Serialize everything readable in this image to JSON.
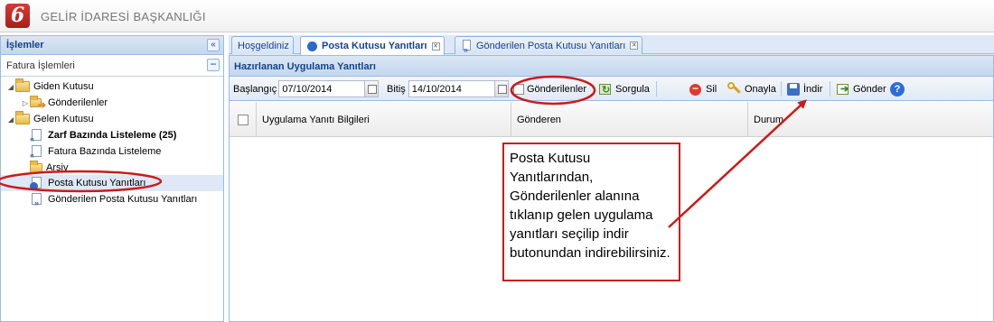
{
  "app": {
    "title": "GELİR İDARESİ BAŞKANLIĞI",
    "logo_letter": "6"
  },
  "sidebar": {
    "title": "İşlemler",
    "section_title": "Fatura İşlemleri",
    "items": [
      {
        "label": "Giden Kutusu"
      },
      {
        "label": "Gönderilenler"
      },
      {
        "label": "Gelen Kutusu"
      },
      {
        "label": "Zarf Bazında Listeleme (25)"
      },
      {
        "label": "Fatura Bazında Listeleme"
      },
      {
        "label": "Arşiv"
      },
      {
        "label": "Posta Kutusu Yanıtları"
      },
      {
        "label": "Gönderilen Posta Kutusu Yanıtları"
      }
    ]
  },
  "tabs": [
    {
      "label": "Hoşgeldiniz"
    },
    {
      "label": "Posta Kutusu Yanıtları"
    },
    {
      "label": "Gönderilen Posta Kutusu Yanıtları"
    }
  ],
  "panel": {
    "title": "Hazırlanan Uygulama Yanıtları"
  },
  "toolbar": {
    "start_label": "Başlangıç",
    "start_value": "07/10/2014",
    "end_label": "Bitiş",
    "end_value": "14/10/2014",
    "sent_label": "Gönderilenler",
    "query_label": "Sorgula",
    "delete_label": "Sil",
    "approve_label": "Onayla",
    "download_label": "İndir",
    "send_label": "Gönder",
    "help_symbol": "?"
  },
  "grid": {
    "columns": [
      "Uygulama Yanıtı Bilgileri",
      "Gönderen",
      "Durum"
    ]
  },
  "callout": {
    "text": "Posta Kutusu Yanıtlarından, Gönderilenler alanına tıklanıp gelen uygulama yanıtları seçilip indir butonundan indirebilirsiniz."
  },
  "colors": {
    "annotation_red": "#cc1a1a",
    "header_blue": "#15428b",
    "panel_bg": "#dfe8f6",
    "border_blue": "#99bbe8"
  }
}
